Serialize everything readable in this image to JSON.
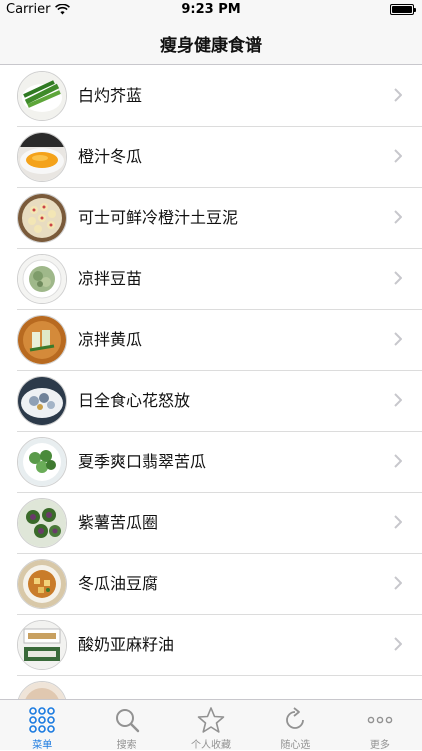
{
  "status_bar": {
    "carrier": "Carrier",
    "time": "9:23 PM"
  },
  "nav": {
    "title": "瘦身健康食谱"
  },
  "recipes": [
    {
      "name": "白灼芥蓝"
    },
    {
      "name": "橙汁冬瓜"
    },
    {
      "name": "可士可鲜冷橙汁土豆泥"
    },
    {
      "name": "凉拌豆苗"
    },
    {
      "name": "凉拌黄瓜"
    },
    {
      "name": "日全食心花怒放"
    },
    {
      "name": "夏季爽口翡翠苦瓜"
    },
    {
      "name": "紫薯苦瓜圈"
    },
    {
      "name": "冬瓜油豆腐"
    },
    {
      "name": "酸奶亚麻籽油"
    }
  ],
  "tabs": [
    {
      "label": "菜单",
      "icon": "grid-icon"
    },
    {
      "label": "搜索",
      "icon": "search-icon"
    },
    {
      "label": "个人收藏",
      "icon": "star-icon"
    },
    {
      "label": "随心选",
      "icon": "refresh-icon"
    },
    {
      "label": "更多",
      "icon": "more-icon"
    }
  ],
  "colors": {
    "accent": "#1a7ae0",
    "inactive": "#929292",
    "bar_background": "#f7f7f7"
  }
}
